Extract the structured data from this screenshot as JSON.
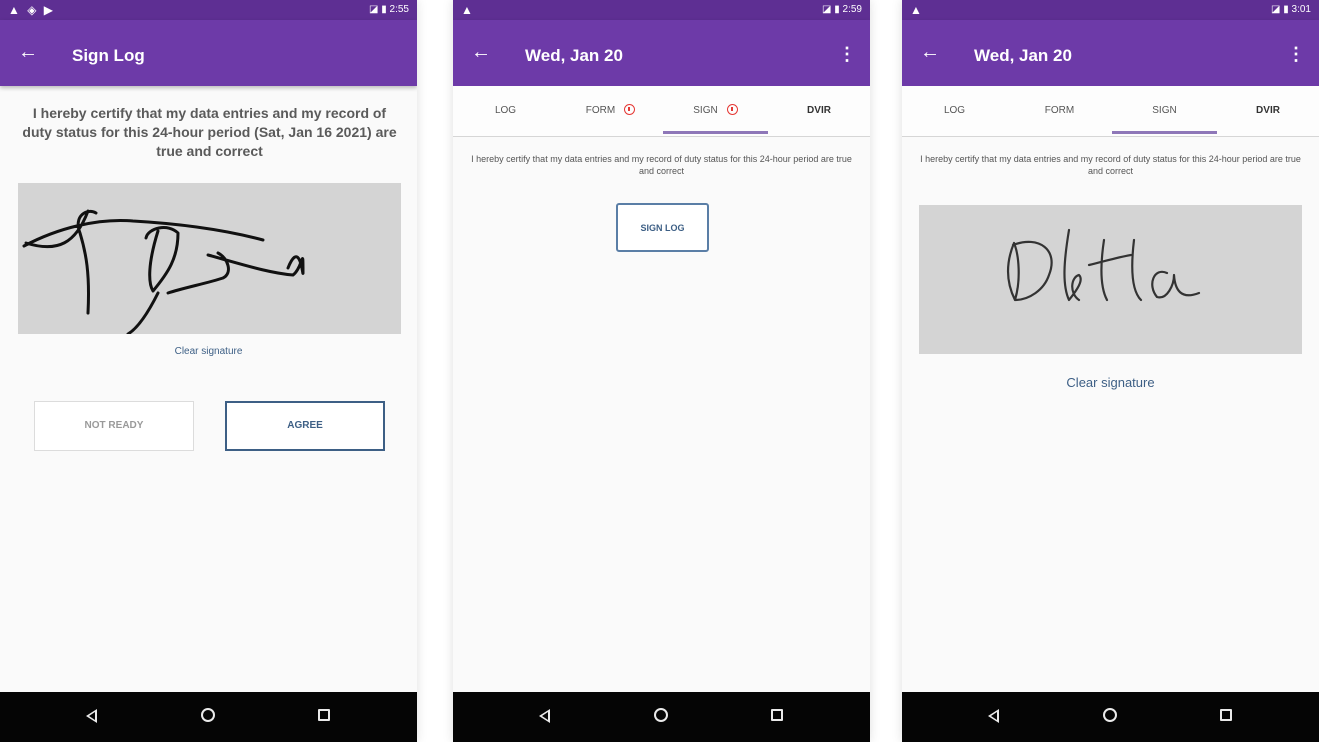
{
  "colors": {
    "status_bar": "#5e2f93",
    "app_bar": "#6d3aa8",
    "signature_pad": "#d4d4d4",
    "link": "#3d5f85",
    "badge_alert": "#e53935",
    "nav_bar": "#050505"
  },
  "screen1": {
    "status": {
      "icons_left": "▲ ◈ ▶",
      "icons_right": "◪ ▮ 2:55"
    },
    "appbar": {
      "back_icon": "←",
      "title": "Sign Log"
    },
    "certification": "I hereby certify that my data entries and my record of duty status for this 24-hour period (Sat, Jan 16 2021) are true and correct",
    "clear_signature": "Clear signature",
    "buttons": {
      "not_ready": "NOT READY",
      "agree": "AGREE"
    }
  },
  "screen2": {
    "status": {
      "icons_left": "▲",
      "icons_right": "◪ ▮ 2:59"
    },
    "appbar": {
      "back_icon": "←",
      "title": "Wed, Jan 20",
      "menu_icon": "⋮"
    },
    "tabs": [
      {
        "label": "LOG"
      },
      {
        "label": "FORM"
      },
      {
        "label": "SIGN"
      },
      {
        "label": "DVIR"
      }
    ],
    "certification": "I hereby certify that my data entries and my record of duty status for this 24-hour period are true and correct",
    "sign_log": "SIGN LOG"
  },
  "screen3": {
    "status": {
      "icons_left": "▲",
      "icons_right": "◪ ▮ 3:01"
    },
    "appbar": {
      "back_icon": "←",
      "title": "Wed, Jan 20",
      "menu_icon": "⋮"
    },
    "tabs": [
      {
        "label": "LOG"
      },
      {
        "label": "FORM"
      },
      {
        "label": "SIGN"
      },
      {
        "label": "DVIR"
      }
    ],
    "certification": "I hereby certify that my data entries and my record of duty status for this 24-hour period are true and correct",
    "clear_signature": "Clear signature"
  }
}
